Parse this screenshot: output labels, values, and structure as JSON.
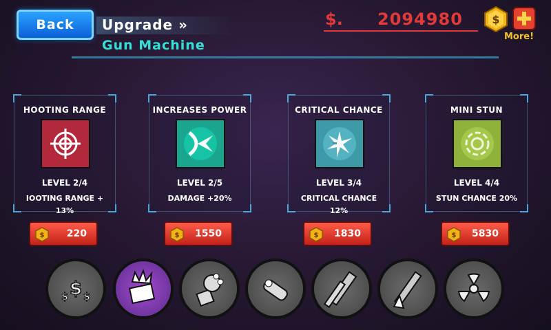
{
  "header": {
    "back_label": "Back",
    "upgrade_label": "Upgrade »",
    "subtitle": "Gun Machine"
  },
  "currency": {
    "symbol": "$.",
    "amount": "2094980",
    "more_label": "More!",
    "color": "#e23a3a"
  },
  "cards": [
    {
      "title": "HOOTING RANGE",
      "icon": "crosshair-icon",
      "icon_bg": "#b3283a",
      "level": "LEVEL 2/4",
      "desc1": "IOOTING RANGE +",
      "desc2": "13%",
      "price": "220"
    },
    {
      "title": "INCREASES POWER",
      "icon": "power-burst-icon",
      "icon_bg": "#1aa58e",
      "level": "LEVEL 2/5",
      "desc1": "DAMAGE +20%",
      "desc2": "",
      "price": "1550"
    },
    {
      "title": "CRITICAL CHANCE",
      "icon": "critical-spark-icon",
      "icon_bg": "#3e9aa6",
      "level": "LEVEL 3/4",
      "desc1": "CRITICAL CHANCE",
      "desc2": "12%",
      "price": "1830"
    },
    {
      "title": "MINI STUN",
      "icon": "stun-ring-icon",
      "icon_bg": "#8fb23c",
      "level": "LEVEL 4/4",
      "desc1": "STUN CHANCE 20%",
      "desc2": "",
      "price": "5830"
    }
  ],
  "weapons": [
    {
      "name": "money-icon",
      "selected": false
    },
    {
      "name": "gun-machine-icon",
      "selected": true
    },
    {
      "name": "grab-hand-icon",
      "selected": false
    },
    {
      "name": "missile-icon",
      "selected": false
    },
    {
      "name": "blade-icon",
      "selected": false
    },
    {
      "name": "laser-icon",
      "selected": false
    },
    {
      "name": "radiation-icon",
      "selected": false
    }
  ]
}
